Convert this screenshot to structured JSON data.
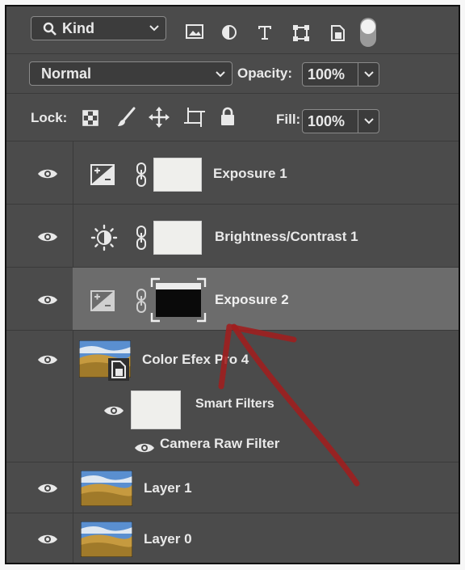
{
  "filter": {
    "kind_label": "Kind"
  },
  "blend": {
    "mode": "Normal",
    "opacity_label": "Opacity:",
    "opacity_value": "100%"
  },
  "lock": {
    "label": "Lock:",
    "fill_label": "Fill:",
    "fill_value": "100%"
  },
  "layers": [
    {
      "name": "Exposure 1"
    },
    {
      "name": "Brightness/Contrast 1"
    },
    {
      "name": "Exposure 2"
    },
    {
      "name": "Color Efex Pro 4",
      "smart_filters_label": "Smart Filters",
      "filter_name": "Camera Raw Filter"
    },
    {
      "name": "Layer 1"
    },
    {
      "name": "Layer 0"
    }
  ],
  "colors": {
    "panel": "#4b4b4b",
    "selected_row": "#6c6c6c",
    "annotation_arrow": "#a01e1e"
  }
}
